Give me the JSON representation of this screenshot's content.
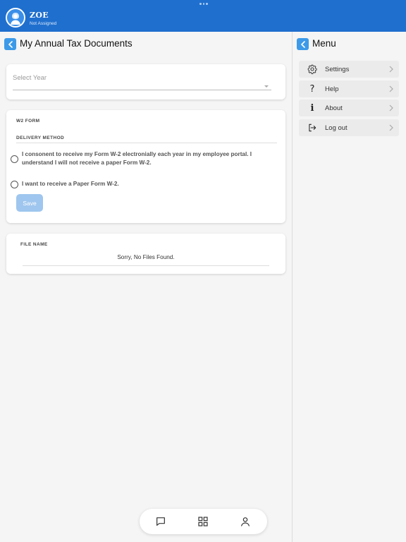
{
  "header": {
    "user_name": "ZOE",
    "user_status": "Not Assigned"
  },
  "main": {
    "title": "My Annual Tax Documents",
    "select_year": {
      "placeholder": "Select Year"
    },
    "w2": {
      "section_title": "W2 FORM",
      "delivery_label": "DELIVERY METHOD",
      "options": [
        {
          "label": "I consonent to receive my Form W-2 electronially each year in my employee portal. I understand I will not receive a paper Form W-2.",
          "selected": false
        },
        {
          "label": "I want to receive a Paper Form W-2.",
          "selected": false
        }
      ],
      "save_label": "Save"
    },
    "files": {
      "column_header": "FILE NAME",
      "empty_message": "Sorry, No Files Found."
    }
  },
  "menu": {
    "title": "Menu",
    "items": [
      {
        "label": "Settings",
        "icon": "gear-icon"
      },
      {
        "label": "Help",
        "icon": "question-icon"
      },
      {
        "label": "About",
        "icon": "info-icon"
      },
      {
        "label": "Log out",
        "icon": "logout-icon"
      }
    ]
  },
  "bottom_nav": {
    "tabs": [
      {
        "icon": "chat-icon"
      },
      {
        "icon": "grid-icon"
      },
      {
        "icon": "person-icon"
      }
    ]
  },
  "colors": {
    "header_bg": "#1f6fce",
    "accent": "#3d9ae8",
    "save_disabled": "#9fc6ee"
  }
}
